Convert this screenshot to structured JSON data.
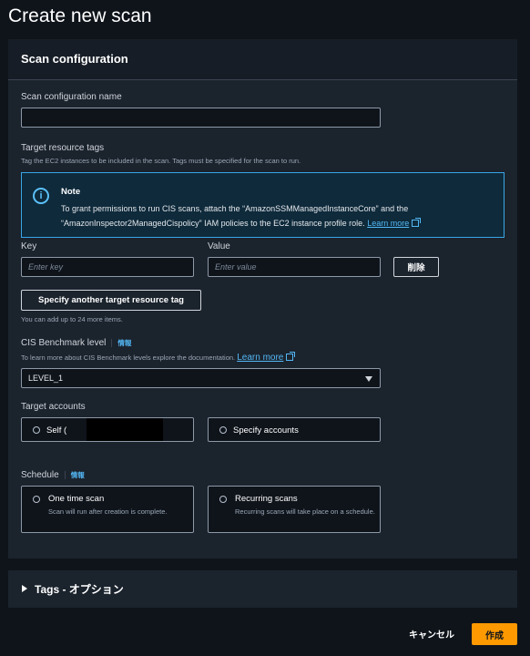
{
  "page": {
    "title": "Create new scan"
  },
  "scan_config": {
    "panel_title": "Scan configuration",
    "name_label": "Scan configuration name",
    "name_value": "",
    "tags_label": "Target resource tags",
    "tags_desc": "Tag the EC2 instances to be included in the scan. Tags must be specified for the scan to run.",
    "note": {
      "title": "Note",
      "body": "To grant permissions to run CIS scans, attach the “AmazonSSMManagedInstanceCore” and the “AmazonInspector2ManagedCispolicy” IAM policies to the EC2 instance profile role.",
      "link": "Learn more"
    },
    "key_label": "Key",
    "key_placeholder": "Enter key",
    "value_label": "Value",
    "value_placeholder": "Enter value",
    "remove_label": "削除",
    "add_tag_label": "Specify another target resource tag",
    "add_tag_hint": "You can add up to 24 more items.",
    "benchmark_label": "CIS Benchmark level",
    "benchmark_info": "情報",
    "benchmark_desc": "To learn more about CIS Benchmark levels explore the documentation.",
    "benchmark_link": "Learn more",
    "benchmark_value": "LEVEL_1",
    "accounts_label": "Target accounts",
    "self_label": "Self (",
    "specify_label": "Specify accounts",
    "schedule_label": "Schedule",
    "schedule_info": "情報",
    "one_time": {
      "title": "One time scan",
      "desc": "Scan will run after creation is complete."
    },
    "recurring": {
      "title": "Recurring scans",
      "desc": "Recurring scans will take place on a schedule."
    }
  },
  "tags_section": {
    "label": "Tags - オプション"
  },
  "footer": {
    "cancel": "キャンセル",
    "create": "作成"
  },
  "colors": {
    "accent": "#ff9900",
    "link": "#53b8f5",
    "info_border": "#3aa7e6"
  }
}
